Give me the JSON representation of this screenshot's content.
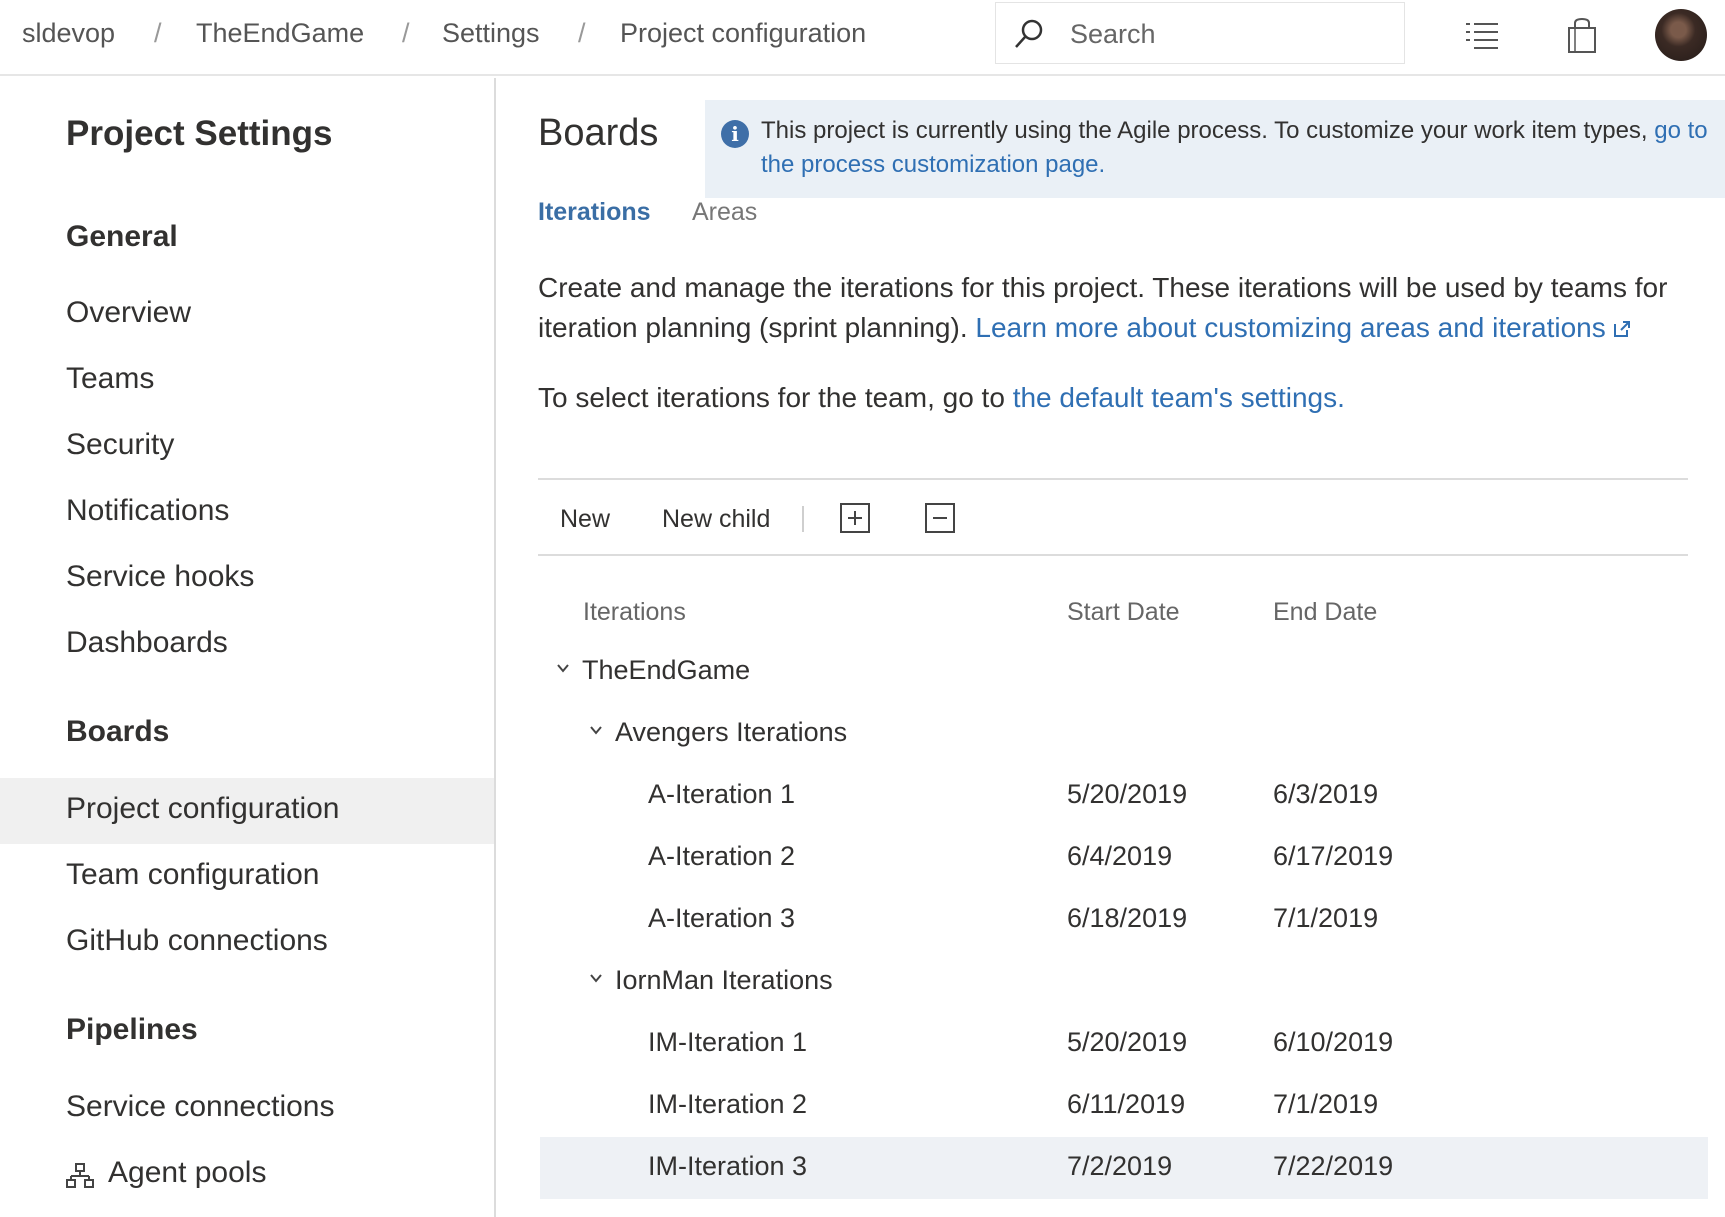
{
  "breadcrumb": {
    "items": [
      "sldevop",
      "TheEndGame",
      "Settings",
      "Project configuration"
    ],
    "separator": "/"
  },
  "search": {
    "placeholder": "Search"
  },
  "topbar_icons": [
    "search-icon",
    "task-list-icon",
    "shopping-bag-icon",
    "avatar"
  ],
  "sidebar": {
    "title": "Project Settings",
    "sections": [
      {
        "heading": "General",
        "items": [
          "Overview",
          "Teams",
          "Security",
          "Notifications",
          "Service hooks",
          "Dashboards"
        ]
      },
      {
        "heading": "Boards",
        "items": [
          "Project configuration",
          "Team configuration",
          "GitHub connections"
        ]
      },
      {
        "heading": "Pipelines",
        "items": [
          "Service connections",
          "Agent pools"
        ]
      }
    ],
    "selected": "Project configuration"
  },
  "main": {
    "title": "Boards",
    "info": {
      "text": "This project is currently using the Agile process. To customize your work item types, ",
      "link": "go to the process customization page."
    },
    "tabs": {
      "active": "Iterations",
      "inactive": "Areas"
    },
    "description": {
      "line1": "Create and manage the iterations for this project. These iterations will be used by teams for",
      "line2_text": "iteration planning (sprint planning). ",
      "line2_link": "Learn more about customizing areas and iterations",
      "line3_text": "To select iterations for the team, go to ",
      "line3_link": "the default team's settings."
    },
    "toolbar": {
      "new": "New",
      "new_child": "New child",
      "expand_icon": "expand-all-icon",
      "collapse_icon": "collapse-all-icon"
    },
    "table": {
      "columns": [
        "Iterations",
        "Start Date",
        "End Date"
      ],
      "rows": [
        {
          "name": "TheEndGame",
          "start": "",
          "end": ""
        },
        {
          "name": "Avengers Iterations",
          "start": "",
          "end": ""
        },
        {
          "name": "A-Iteration 1",
          "start": "5/20/2019",
          "end": "6/3/2019"
        },
        {
          "name": "A-Iteration 2",
          "start": "6/4/2019",
          "end": "6/17/2019"
        },
        {
          "name": "A-Iteration 3",
          "start": "6/18/2019",
          "end": "7/1/2019"
        },
        {
          "name": "IornMan Iterations",
          "start": "",
          "end": ""
        },
        {
          "name": "IM-Iteration 1",
          "start": "5/20/2019",
          "end": "6/10/2019"
        },
        {
          "name": "IM-Iteration 2",
          "start": "6/11/2019",
          "end": "7/1/2019"
        },
        {
          "name": "IM-Iteration 3",
          "start": "7/2/2019",
          "end": "7/22/2019"
        }
      ],
      "selected_row": "IM-Iteration 3"
    }
  },
  "colors": {
    "link": "#2f6fb3",
    "active_tab": "#3a6ea5",
    "info_bg": "#eaf0f6",
    "selected_bg": "#f0f0f0"
  }
}
